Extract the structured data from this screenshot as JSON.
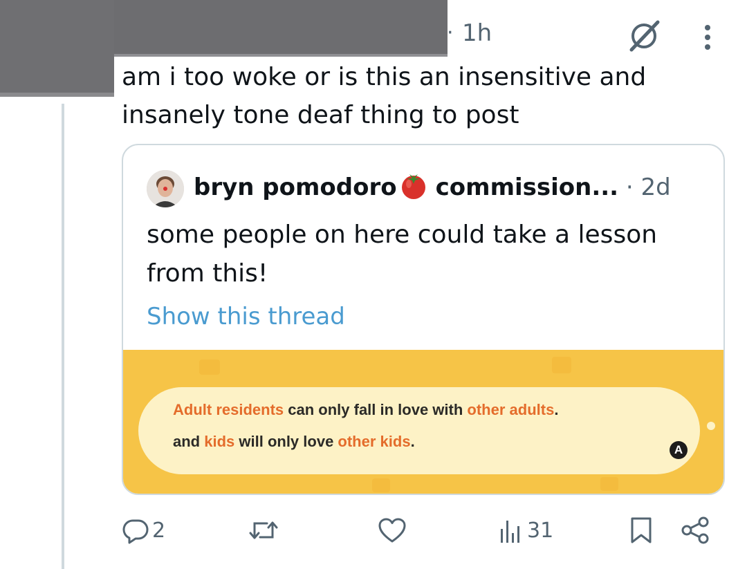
{
  "tweet": {
    "time": "1h",
    "text": "am i too woke or is this an insensitive and insanely tone deaf thing to post"
  },
  "quote": {
    "author_name": "bryn pomodoro",
    "author_suffix": "commission...",
    "separator": "·",
    "time": "2d",
    "text": "some people on here could take a lesson from this!",
    "show_thread": "Show this thread",
    "media": {
      "line1_a": "Adult residents",
      "line1_b": " can only fall in love with ",
      "line1_c": "other adults",
      "line1_d": ".",
      "line2_a": "and ",
      "line2_b": "kids",
      "line2_c": " will only love ",
      "line2_d": "other kids",
      "line2_e": ".",
      "button": "A"
    }
  },
  "actions": {
    "replies": "2",
    "views": "31"
  },
  "colors": {
    "accent_blue": "#1d9bf0",
    "muted": "#536471",
    "media_yellow": "#f6c447",
    "media_highlight": "#e46c2b"
  }
}
